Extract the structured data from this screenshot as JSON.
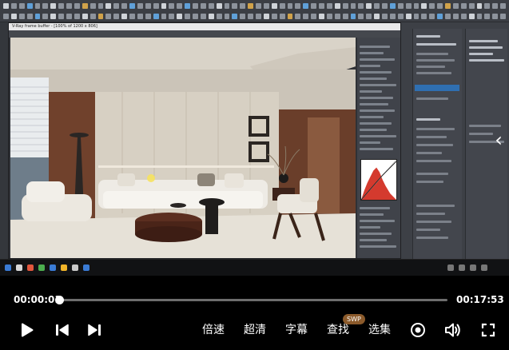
{
  "player": {
    "current_time": "00:00:01",
    "total_time": "00:17:53",
    "progress": 0.001,
    "buttons": {
      "speed": "倍速",
      "quality": "超清",
      "subtitle": "字幕",
      "search": "查找",
      "episodes": "选集"
    },
    "search_badge": "SWP",
    "icons": {
      "play": "play-icon",
      "previous": "skip-previous-icon",
      "next": "skip-next-icon",
      "loop": "radio-target-icon",
      "volume": "volume-icon",
      "fullscreen": "fullscreen-icon",
      "side_panel": "chevron-left-icon"
    }
  },
  "video_frame": {
    "render_window_title": "V-Ray frame buffer - [100% of 1200 x 806]"
  },
  "colors": {
    "progress_fill": "#ffffff",
    "progress_track": "#6d6d6d",
    "badge": "#8b5a2b"
  }
}
